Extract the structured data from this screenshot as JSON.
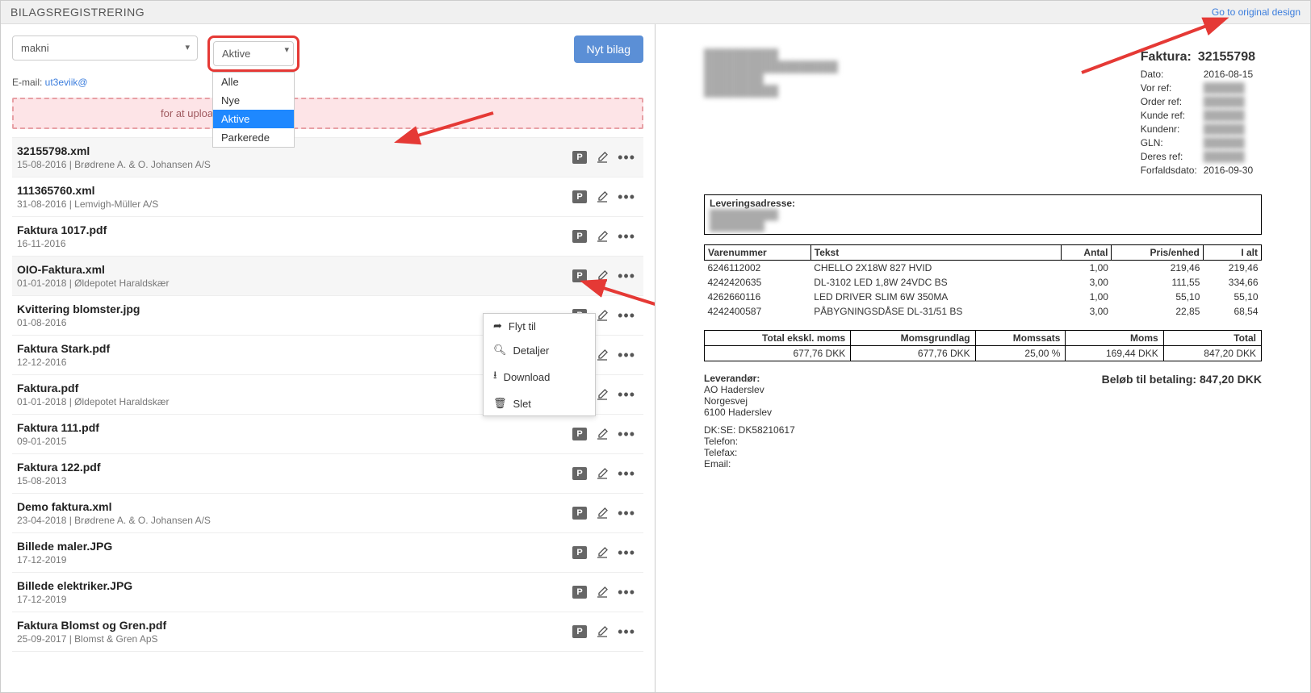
{
  "header": {
    "title": "BILAGSREGISTRERING",
    "design_link": "Go to original design"
  },
  "controls": {
    "account_value": "makni",
    "status_value": "Aktive",
    "status_options": [
      "Alle",
      "Nye",
      "Aktive",
      "Parkerede"
    ],
    "new_btn": "Nyt bilag",
    "email_label": "E-mail: ",
    "email_value": "ut3eviik@",
    "dropzone_text": "for at uploade dem."
  },
  "ctx_menu": {
    "move": "Flyt til",
    "details": "Detaljer",
    "download": "Download",
    "delete": "Slet"
  },
  "files": [
    {
      "name": "32155798.xml",
      "sub": "15-08-2016 | Brødrene A. & O. Johansen A/S"
    },
    {
      "name": "111365760.xml",
      "sub": "31-08-2016 | Lemvigh-Müller A/S"
    },
    {
      "name": "Faktura 1017.pdf",
      "sub": "16-11-2016"
    },
    {
      "name": "OIO-Faktura.xml",
      "sub": "01-01-2018 | Øldepotet Haraldskær"
    },
    {
      "name": "Kvittering blomster.jpg",
      "sub": "01-08-2016"
    },
    {
      "name": "Faktura Stark.pdf",
      "sub": "12-12-2016"
    },
    {
      "name": "Faktura.pdf",
      "sub": "01-01-2018 | Øldepotet Haraldskær"
    },
    {
      "name": "Faktura 111.pdf",
      "sub": "09-01-2015"
    },
    {
      "name": "Faktura 122.pdf",
      "sub": "15-08-2013"
    },
    {
      "name": "Demo faktura.xml",
      "sub": "23-04-2018 | Brødrene A. & O. Johansen A/S"
    },
    {
      "name": "Billede maler.JPG",
      "sub": "17-12-2019"
    },
    {
      "name": "Billede elektriker.JPG",
      "sub": "17-12-2019"
    },
    {
      "name": "Faktura Blomst og Gren.pdf",
      "sub": "25-09-2017 | Blomst & Gren ApS"
    }
  ],
  "invoice": {
    "title_label": "Faktura:",
    "number": "32155798",
    "fields": {
      "Dato:": "2016-08-15",
      "Vor ref:": "",
      "Order ref:": "",
      "Kunde ref:": "",
      "Kundenr:": "",
      "GLN:": "",
      "Deres ref:": "",
      "Forfaldsdato:": "2016-09-30"
    },
    "delivery_label": "Leveringsadresse:",
    "cols": {
      "item": "Varenummer",
      "text": "Tekst",
      "qty": "Antal",
      "unit": "Pris/enhed",
      "tot": "I alt"
    },
    "lines": [
      {
        "item": "6246112002",
        "text": "CHELLO 2X18W 827 HVID",
        "qty": "1,00",
        "unit": "219,46",
        "tot": "219,46"
      },
      {
        "item": "4242420635",
        "text": "DL-3102 LED 1,8W 24VDC BS",
        "qty": "3,00",
        "unit": "111,55",
        "tot": "334,66"
      },
      {
        "item": "4262660116",
        "text": "LED DRIVER SLIM 6W 350MA",
        "qty": "1,00",
        "unit": "55,10",
        "tot": "55,10"
      },
      {
        "item": "4242400587",
        "text": "PÅBYGNINGSDÅSE DL-31/51 BS",
        "qty": "3,00",
        "unit": "22,85",
        "tot": "68,54"
      }
    ],
    "totals_head": {
      "ex": "Total ekskl. moms",
      "base": "Momsgrundlag",
      "rate": "Momssats",
      "vat": "Moms",
      "total": "Total"
    },
    "totals_row": {
      "ex": "677,76 DKK",
      "base": "677,76 DKK",
      "rate": "25,00 %",
      "vat": "169,44 DKK",
      "total": "847,20 DKK"
    },
    "supplier_label": "Leverandør:",
    "supplier": [
      "AO Haderslev",
      "Norgesvej",
      "6100 Haderslev",
      "",
      "DK:SE: DK58210617",
      "Telefon:",
      "Telefax:",
      "Email:"
    ],
    "pay_label": "Beløb til betaling: 847,20 DKK"
  }
}
